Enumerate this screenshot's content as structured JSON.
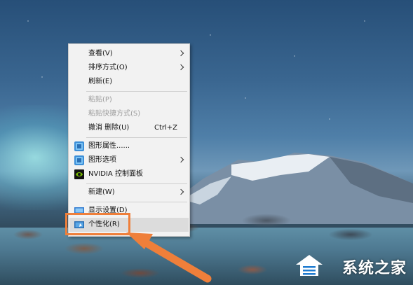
{
  "context_menu": {
    "items": [
      {
        "label": "查看(V)",
        "submenu": true,
        "disabled": false
      },
      {
        "label": "排序方式(O)",
        "submenu": true,
        "disabled": false
      },
      {
        "label": "刷新(E)",
        "submenu": false,
        "disabled": false
      },
      {
        "label": "粘贴(P)",
        "submenu": false,
        "disabled": true
      },
      {
        "label": "粘贴快捷方式(S)",
        "submenu": false,
        "disabled": true
      },
      {
        "label": "撤消 删除(U)",
        "shortcut": "Ctrl+Z",
        "submenu": false,
        "disabled": false
      },
      {
        "label": "图形属性......",
        "icon": "intel-graphics-icon",
        "submenu": false,
        "disabled": false
      },
      {
        "label": "图形选项",
        "icon": "intel-graphics-icon",
        "submenu": true,
        "disabled": false
      },
      {
        "label": "NVIDIA 控制面板",
        "icon": "nvidia-icon",
        "submenu": false,
        "disabled": false
      },
      {
        "label": "新建(W)",
        "submenu": true,
        "disabled": false
      },
      {
        "label": "显示设置(D)",
        "icon": "display-settings-icon",
        "submenu": false,
        "disabled": false
      },
      {
        "label": "个性化(R)",
        "icon": "personalize-icon",
        "submenu": false,
        "disabled": false,
        "highlighted": true
      }
    ]
  },
  "annotation": {
    "highlight_color": "#ef7f3a"
  },
  "watermark": {
    "text": "系统之家",
    "icon": "house-logo-icon"
  }
}
